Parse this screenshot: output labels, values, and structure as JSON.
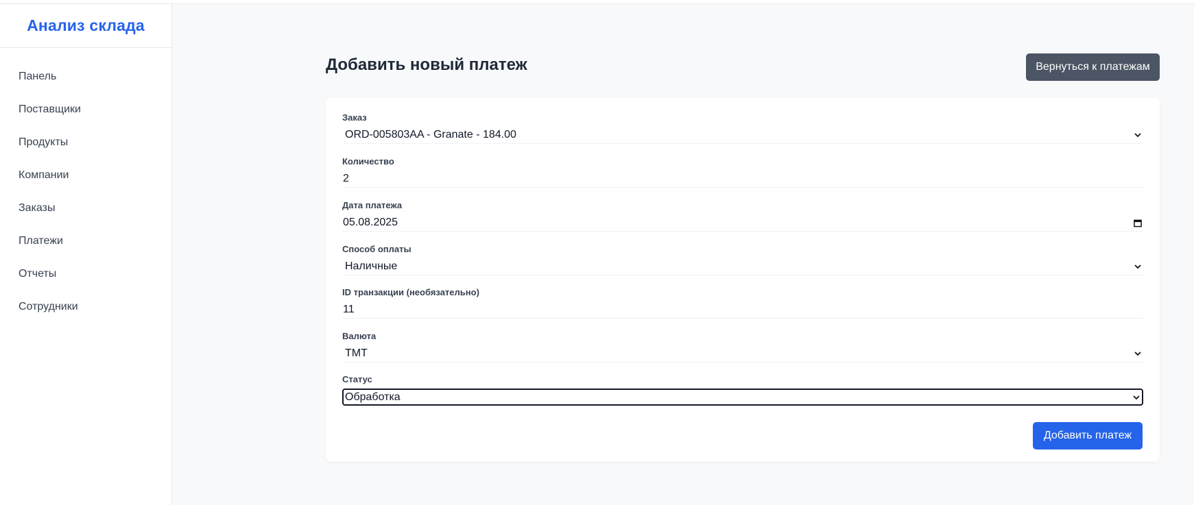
{
  "sidebar": {
    "brand": "Анализ склада",
    "items": [
      {
        "label": "Панель"
      },
      {
        "label": "Поставщики"
      },
      {
        "label": "Продукты"
      },
      {
        "label": "Компании"
      },
      {
        "label": "Заказы"
      },
      {
        "label": "Платежи"
      },
      {
        "label": "Отчеты"
      },
      {
        "label": "Сотрудники"
      }
    ]
  },
  "header": {
    "title": "Добавить новый платеж",
    "back_label": "Вернуться к платежам"
  },
  "form": {
    "order": {
      "label": "Заказ",
      "value": "ORD-005803AA - Granate - 184.00"
    },
    "quantity": {
      "label": "Количество",
      "value": "2"
    },
    "payment_date": {
      "label": "Дата платежа",
      "value": "05.08.2025"
    },
    "payment_method": {
      "label": "Способ оплаты",
      "value": "Наличные"
    },
    "transaction_id": {
      "label": "ID транзакции (необязательно)",
      "value": "11"
    },
    "currency": {
      "label": "Валюта",
      "value": "TMT"
    },
    "status": {
      "label": "Статус",
      "value": "Обработка"
    },
    "submit_label": "Добавить платеж"
  },
  "colors": {
    "accent": "#2563eb",
    "secondary_button": "#4b5563",
    "background": "#f8f9fb"
  },
  "icons": {
    "select": "chevron-down-icon",
    "date": "calendar-icon"
  }
}
